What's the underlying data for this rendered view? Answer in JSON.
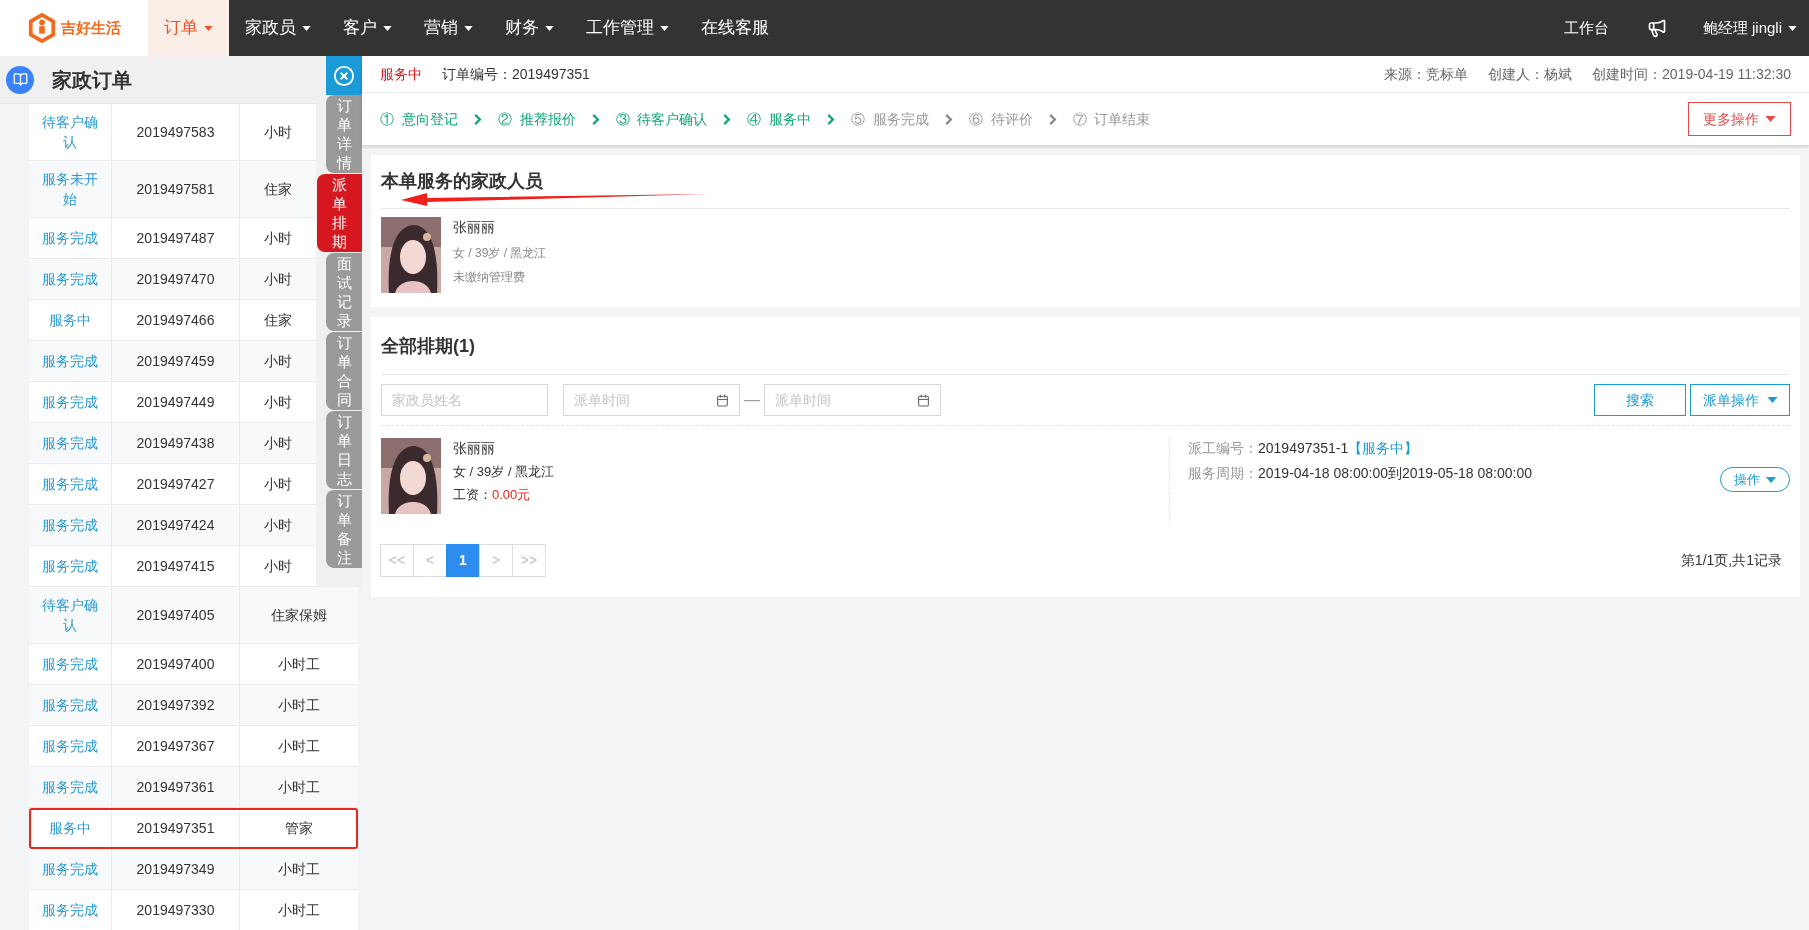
{
  "nav": {
    "logo_text": "吉好生活",
    "items": [
      {
        "label": "订单",
        "dropdown": true,
        "selected": true
      },
      {
        "label": "家政员",
        "dropdown": true,
        "selected": false
      },
      {
        "label": "客户",
        "dropdown": true,
        "selected": false
      },
      {
        "label": "营销",
        "dropdown": true,
        "selected": false
      },
      {
        "label": "财务",
        "dropdown": true,
        "selected": false
      },
      {
        "label": "工作管理",
        "dropdown": true,
        "selected": false
      },
      {
        "label": "在线客服",
        "dropdown": false,
        "selected": false
      }
    ],
    "workbench": "工作台",
    "user": "鲍经理 jingli"
  },
  "order_list": {
    "title": "家政订单",
    "rows": [
      {
        "status": "待客户确认",
        "number": "2019497583",
        "type": "小时",
        "highlighted": false
      },
      {
        "status": "服务未开始",
        "number": "2019497581",
        "type": "住家",
        "highlighted": false
      },
      {
        "status": "服务完成",
        "number": "2019497487",
        "type": "小时",
        "highlighted": false
      },
      {
        "status": "服务完成",
        "number": "2019497470",
        "type": "小时",
        "highlighted": false
      },
      {
        "status": "服务中",
        "number": "2019497466",
        "type": "住家",
        "highlighted": false
      },
      {
        "status": "服务完成",
        "number": "2019497459",
        "type": "小时",
        "highlighted": false
      },
      {
        "status": "服务完成",
        "number": "2019497449",
        "type": "小时",
        "highlighted": false
      },
      {
        "status": "服务完成",
        "number": "2019497438",
        "type": "小时",
        "highlighted": false
      },
      {
        "status": "服务完成",
        "number": "2019497427",
        "type": "小时",
        "highlighted": false
      },
      {
        "status": "服务完成",
        "number": "2019497424",
        "type": "小时",
        "highlighted": false
      },
      {
        "status": "服务完成",
        "number": "2019497415",
        "type": "小时",
        "highlighted": false
      },
      {
        "status": "待客户确认",
        "number": "2019497405",
        "type": "住家保姆",
        "highlighted": false
      },
      {
        "status": "服务完成",
        "number": "2019497400",
        "type": "小时工",
        "highlighted": false
      },
      {
        "status": "服务完成",
        "number": "2019497392",
        "type": "小时工",
        "highlighted": false
      },
      {
        "status": "服务完成",
        "number": "2019497367",
        "type": "小时工",
        "highlighted": false
      },
      {
        "status": "服务完成",
        "number": "2019497361",
        "type": "小时工",
        "highlighted": false
      },
      {
        "status": "服务中",
        "number": "2019497351",
        "type": "管家",
        "highlighted": true
      },
      {
        "status": "服务完成",
        "number": "2019497349",
        "type": "小时工",
        "highlighted": false
      },
      {
        "status": "服务完成",
        "number": "2019497330",
        "type": "小时工",
        "highlighted": false
      }
    ]
  },
  "side_tabs": [
    {
      "label": "订单详情",
      "selected": false
    },
    {
      "label": "派单排期",
      "selected": true
    },
    {
      "label": "面试记录",
      "selected": false
    },
    {
      "label": "订单合同",
      "selected": false
    },
    {
      "label": "订单日志",
      "selected": false
    },
    {
      "label": "订单备注",
      "selected": false
    }
  ],
  "order": {
    "status": "服务中",
    "number": "订单编号：2019497351",
    "source": "来源：竞标单",
    "creator": "创建人：杨斌",
    "created": "创建时间：2019-04-19 11:32:30",
    "more_button": "更多操作",
    "steps": [
      {
        "num": "①",
        "label": "意向登记",
        "done": true
      },
      {
        "num": "②",
        "label": "推荐报价",
        "done": true
      },
      {
        "num": "③",
        "label": "待客户确认",
        "done": true
      },
      {
        "num": "④",
        "label": "服务中",
        "done": true
      },
      {
        "num": "⑤",
        "label": "服务完成",
        "done": false
      },
      {
        "num": "⑥",
        "label": "待评价",
        "done": false
      },
      {
        "num": "⑦",
        "label": "订单结束",
        "done": false
      }
    ]
  },
  "staff_card": {
    "title": "本单服务的家政人员",
    "name": "张丽丽",
    "info": "女 / 39岁 / 黑龙江",
    "fee_status": "未缴纳管理费"
  },
  "schedule_card": {
    "title": "全部排期(1)",
    "name_placeholder": "家政员姓名",
    "from_placeholder": "派单时间",
    "separator": "—",
    "to_placeholder": "派单时间",
    "search_button": "搜索",
    "dispatch_button": "派单操作",
    "entries": [
      {
        "name": "张丽丽",
        "info": "女 / 39岁 / 黑龙江",
        "wage_label": "工资：",
        "wage": "0.00元",
        "dispatch_label": "派工编号：",
        "dispatch_no": "2019497351-1",
        "dispatch_status": "【服务中】",
        "period_label": "服务周期：",
        "period": "2019-04-18 08:00:00到2019-05-18 08:00:00",
        "action_button": "操作"
      }
    ],
    "pagination": {
      "pages": [
        {
          "label": "<<",
          "selected": false
        },
        {
          "label": "<",
          "selected": false
        },
        {
          "label": "1",
          "selected": true
        },
        {
          "label": ">",
          "selected": false
        },
        {
          "label": ">>",
          "selected": false
        }
      ],
      "summary": "第1/1页,共1记录"
    }
  }
}
